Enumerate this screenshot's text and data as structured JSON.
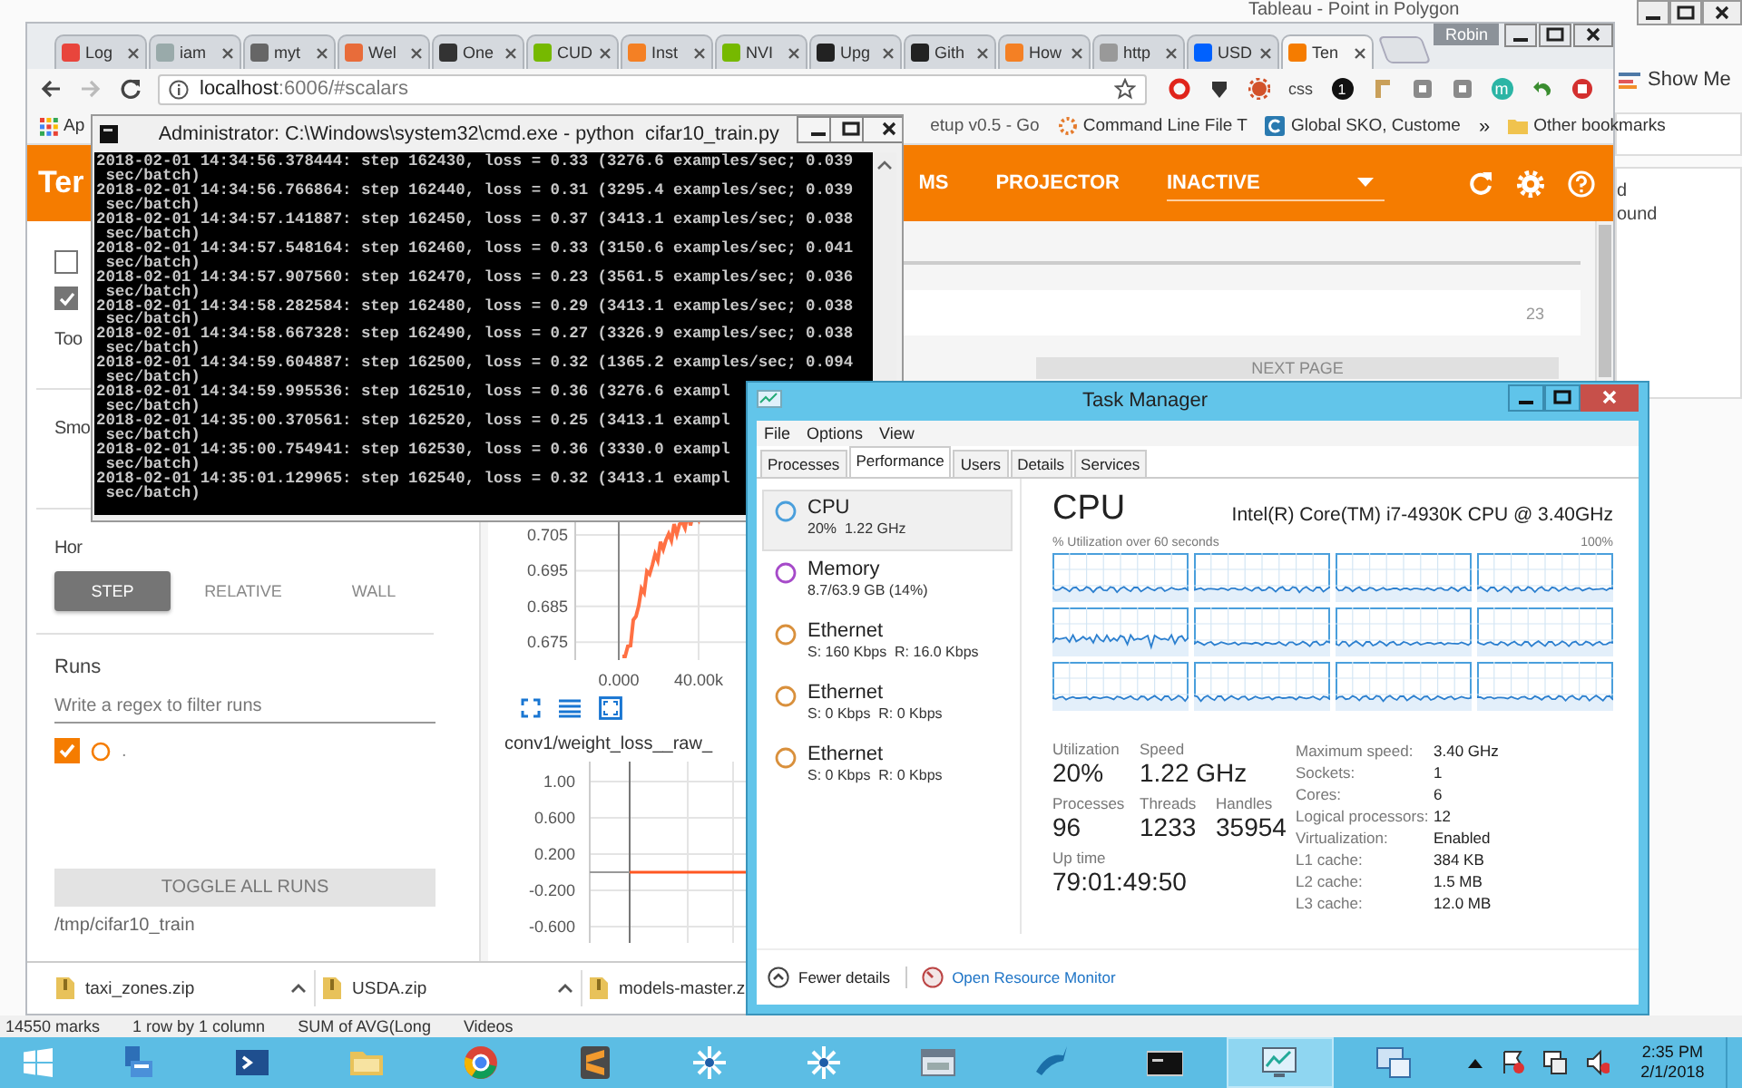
{
  "background_window": {
    "title": "Tableau - Point in Polygon",
    "pane_label": "Show Me",
    "side_texts": [
      "d",
      "ound"
    ],
    "status_bar": [
      "14550 marks",
      "1 row by 1 column",
      "SUM of AVG(Long",
      "Videos"
    ]
  },
  "browser": {
    "user": "Robin",
    "tabs": [
      {
        "title": "Log",
        "selected": false
      },
      {
        "title": "iam",
        "selected": false
      },
      {
        "title": "myt",
        "selected": false
      },
      {
        "title": "Wel",
        "selected": false
      },
      {
        "title": "One",
        "selected": false
      },
      {
        "title": "CUD",
        "selected": false
      },
      {
        "title": "Inst",
        "selected": false
      },
      {
        "title": "NVI",
        "selected": false
      },
      {
        "title": "Upg",
        "selected": false
      },
      {
        "title": "Gith",
        "selected": false
      },
      {
        "title": "How",
        "selected": false
      },
      {
        "title": "http",
        "selected": false
      },
      {
        "title": "USD",
        "selected": false
      },
      {
        "title": "Ten",
        "selected": true
      }
    ],
    "url": {
      "host": "localhost",
      "path": ":6006/#scalars"
    },
    "extensions": [
      {
        "kind": "ring"
      },
      {
        "kind": "dark"
      },
      {
        "kind": "gear"
      },
      {
        "kind": "text",
        "label": "css"
      },
      {
        "kind": "badge",
        "label": "1"
      },
      {
        "kind": "tool"
      },
      {
        "kind": "square"
      },
      {
        "kind": "square"
      },
      {
        "kind": "letter",
        "label": "m"
      },
      {
        "kind": "arrow"
      },
      {
        "kind": "stop"
      }
    ],
    "bookmarks": [
      {
        "kind": "apps",
        "label": "Ap"
      },
      {
        "kind": "page",
        "label": "etup v0.5 - Go"
      },
      {
        "kind": "spinner",
        "label": "Command Line File T"
      },
      {
        "kind": "letter",
        "label": "Global SKO, Custome"
      }
    ],
    "more": "»",
    "other_bookmarks": "Other bookmarks",
    "downloads": [
      "taxi_zones.zip",
      "USDA.zip",
      "models-master.z"
    ]
  },
  "tensorboard": {
    "brand": "Ter",
    "nav": [
      {
        "label": "MS",
        "selected": false
      },
      {
        "label": "PROJECTOR",
        "selected": false
      }
    ],
    "dropdown": "INACTIVE",
    "sidebar": {
      "checkboxes": [
        {
          "checked": false
        },
        {
          "checked": true
        }
      ],
      "labels": [
        "Too",
        "Smo",
        "Hor"
      ],
      "axis_modes": [
        {
          "label": "STEP",
          "selected": true
        },
        {
          "label": "RELATIVE",
          "selected": false
        },
        {
          "label": "WALL",
          "selected": false
        }
      ],
      "runs_title": "Runs",
      "runs_filter": {
        "placeholder": "Write a regex to filter runs"
      },
      "runs": [
        {
          "label": ".",
          "checked": true,
          "color": "#f57c00"
        }
      ],
      "toggle_all": "TOGGLE ALL RUNS",
      "run_path": "/tmp/cifar10_train"
    },
    "main": {
      "page_number": "23",
      "next_page": "NEXT PAGE",
      "charts": [
        {
          "yticks": [
            "0.705",
            "0.695",
            "0.685",
            "0.675"
          ],
          "xticks": [
            "0.000",
            "40.00k"
          ]
        },
        {
          "title": "conv1/weight_loss__raw_",
          "yticks": [
            "1.00",
            "0.600",
            "0.200",
            "-0.200",
            "-0.600"
          ]
        }
      ]
    }
  },
  "cmd": {
    "title": "Administrator: C:\\Windows\\system32\\cmd.exe - python  cifar10_train.py",
    "lines": [
      "2018-02-01 14:34:56.378444: step 162430, loss = 0.33 (3276.6 examples/sec; 0.039",
      " sec/batch)",
      "2018-02-01 14:34:56.766864: step 162440, loss = 0.31 (3295.4 examples/sec; 0.039",
      " sec/batch)",
      "2018-02-01 14:34:57.141887: step 162450, loss = 0.37 (3413.1 examples/sec; 0.038",
      " sec/batch)",
      "2018-02-01 14:34:57.548164: step 162460, loss = 0.33 (3150.6 examples/sec; 0.041",
      " sec/batch)",
      "2018-02-01 14:34:57.907560: step 162470, loss = 0.23 (3561.5 examples/sec; 0.036",
      " sec/batch)",
      "2018-02-01 14:34:58.282584: step 162480, loss = 0.29 (3413.1 examples/sec; 0.038",
      " sec/batch)",
      "2018-02-01 14:34:58.667328: step 162490, loss = 0.27 (3326.9 examples/sec; 0.038",
      " sec/batch)",
      "2018-02-01 14:34:59.604887: step 162500, loss = 0.32 (1365.2 examples/sec; 0.094",
      " sec/batch)",
      "2018-02-01 14:34:59.995536: step 162510, loss = 0.36 (3276.6 exampl",
      " sec/batch)",
      "2018-02-01 14:35:00.370561: step 162520, loss = 0.25 (3413.1 exampl",
      " sec/batch)",
      "2018-02-01 14:35:00.754941: step 162530, loss = 0.36 (3330.0 exampl",
      " sec/batch)",
      "2018-02-01 14:35:01.129965: step 162540, loss = 0.32 (3413.1 exampl",
      " sec/batch)"
    ]
  },
  "task_manager": {
    "title": "Task Manager",
    "menu": [
      "File",
      "Options",
      "View"
    ],
    "tabs": [
      {
        "label": "Processes",
        "selected": false
      },
      {
        "label": "Performance",
        "selected": true
      },
      {
        "label": "Users",
        "selected": false
      },
      {
        "label": "Details",
        "selected": false
      },
      {
        "label": "Services",
        "selected": false
      }
    ],
    "resources": [
      {
        "name": "CPU",
        "detail": "20%  1.22 GHz",
        "color": "#4a9fdc",
        "selected": true
      },
      {
        "name": "Memory",
        "detail": "8.7/63.9 GB (14%)",
        "color": "#a64ac9",
        "selected": false
      },
      {
        "name": "Ethernet",
        "detail": "S: 160 Kbps  R: 16.0 Kbps",
        "color": "#d9903c",
        "selected": false
      },
      {
        "name": "Ethernet",
        "detail": "S: 0 Kbps  R: 0 Kbps",
        "color": "#d9903c",
        "selected": false
      },
      {
        "name": "Ethernet",
        "detail": "S: 0 Kbps  R: 0 Kbps",
        "color": "#d9903c",
        "selected": false
      }
    ],
    "heading": "CPU",
    "model": "Intel(R) Core(TM) i7-4930K CPU @ 3.40GHz",
    "graph_caption": "% Utilization over 60 seconds",
    "graph_max": "100%",
    "stats": [
      [
        {
          "label": "Utilization",
          "value": "20%"
        },
        {
          "label": "Speed",
          "value": "1.22 GHz"
        }
      ],
      [
        {
          "label": "Processes",
          "value": "96"
        },
        {
          "label": "Threads",
          "value": "1233"
        },
        {
          "label": "Handles",
          "value": "35954"
        }
      ],
      [
        {
          "label": "Up time",
          "value": "79:01:49:50"
        }
      ]
    ],
    "specs": [
      {
        "label": "Maximum speed:",
        "value": "3.40 GHz"
      },
      {
        "label": "Sockets:",
        "value": "1"
      },
      {
        "label": "Cores:",
        "value": "6"
      },
      {
        "label": "Logical processors:",
        "value": "12"
      },
      {
        "label": "Virtualization:",
        "value": "Enabled"
      },
      {
        "label": "L1 cache:",
        "value": "384 KB"
      },
      {
        "label": "L2 cache:",
        "value": "1.5 MB"
      },
      {
        "label": "L3 cache:",
        "value": "12.0 MB"
      }
    ],
    "fewer_details": "Fewer details",
    "resource_monitor": "Open Resource Monitor"
  },
  "taskbar": {
    "apps": [
      {
        "kind": "server",
        "active": false
      },
      {
        "kind": "shell",
        "active": false
      },
      {
        "kind": "folder",
        "active": false
      },
      {
        "kind": "browser",
        "active": false
      },
      {
        "kind": "editor",
        "active": false
      },
      {
        "kind": "grid",
        "active": false
      },
      {
        "kind": "grid",
        "active": false
      },
      {
        "kind": "window",
        "active": false
      },
      {
        "kind": "fish",
        "active": false
      },
      {
        "kind": "console",
        "active": false
      },
      {
        "kind": "monitor",
        "active": true
      },
      {
        "kind": "network",
        "active": false
      }
    ],
    "time": "2:35 PM",
    "date": "2/1/2018"
  }
}
